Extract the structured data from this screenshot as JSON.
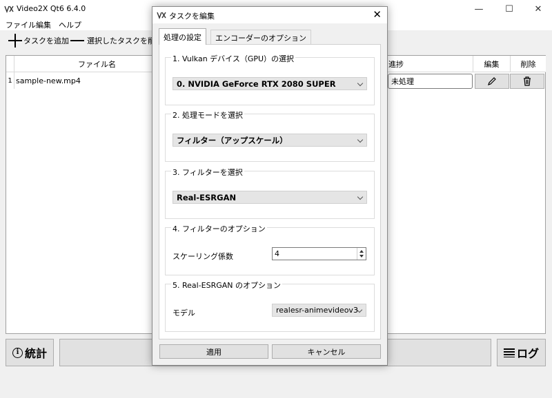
{
  "app": {
    "title": "Video2X Qt6 6.4.0",
    "menu": [
      "ファイル",
      "編集",
      "ヘルプ"
    ],
    "toolbar": {
      "add_task": "タスクを追加",
      "remove_task": "選択したタスクを削除"
    },
    "table": {
      "headers": {
        "filename": "ファイル名",
        "progress": "進捗",
        "edit": "編集",
        "delete": "削除"
      },
      "rows": [
        {
          "num": "1",
          "filename": "sample-new.mp4",
          "progress": "未処理"
        }
      ]
    },
    "bottom": {
      "stats": "統計",
      "log": "ログ"
    }
  },
  "dialog": {
    "title": "タスクを編集",
    "tabs": [
      "処理の設定",
      "エンコーダーのオプション"
    ],
    "groups": {
      "gpu": {
        "title": "1. Vulkan デバイス（GPU）の選択",
        "value": "0. NVIDIA GeForce RTX 2080 SUPER"
      },
      "mode": {
        "title": "2. 処理モードを選択",
        "value": "フィルター（アップスケール）"
      },
      "filter": {
        "title": "3. フィルターを選択",
        "value": "Real-ESRGAN"
      },
      "filter_options": {
        "title": "4. フィルターのオプション",
        "label": "スケーリング係数",
        "value": "4"
      },
      "esrgan_options": {
        "title": "5. Real-ESRGAN のオプション",
        "label": "モデル",
        "value": "realesr-animevideov3"
      }
    },
    "buttons": {
      "apply": "適用",
      "cancel": "キャンセル"
    }
  }
}
